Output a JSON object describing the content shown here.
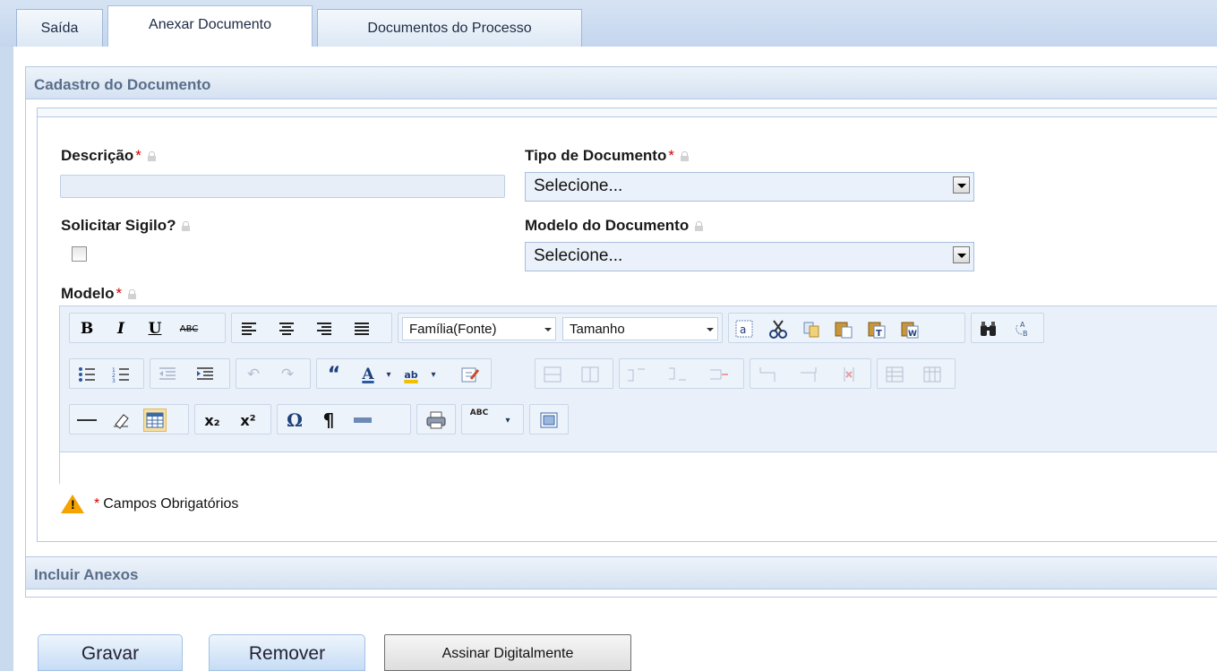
{
  "tabs": [
    {
      "label": "Saída",
      "active": false
    },
    {
      "label": "Anexar Documento",
      "active": true
    },
    {
      "label": "Documentos do Processo",
      "active": false
    }
  ],
  "panel": {
    "title": "Cadastro do Documento"
  },
  "form": {
    "descricao": {
      "label": "Descrição",
      "required": "*",
      "value": ""
    },
    "tipo": {
      "label": "Tipo de Documento",
      "required": "*",
      "selected": "Selecione..."
    },
    "sigilo": {
      "label": "Solicitar Sigilo?",
      "checked": false
    },
    "modelo_doc": {
      "label": "Modelo do Documento",
      "selected": "Selecione..."
    },
    "modelo": {
      "label": "Modelo",
      "required": "*"
    }
  },
  "editor": {
    "font_family": "Família(Fonte)",
    "font_size": "Tamanho",
    "icons": {
      "bold": "B",
      "italic": "I",
      "underline": "U",
      "strike": "ABC",
      "omega": "Ω",
      "pilcrow": "¶",
      "subscript": "x₂",
      "superscript": "x²",
      "quote": "“",
      "font_color": "A",
      "highlight": "ab",
      "spell": "ABC"
    }
  },
  "legend": {
    "mark": "*",
    "text": "Campos Obrigatórios"
  },
  "panel2": {
    "title": "Incluir Anexos"
  },
  "buttons": {
    "gravar": "Gravar",
    "remover": "Remover",
    "assinar": "Assinar Digitalmente"
  },
  "colors": {
    "required": "#d20000",
    "warning": "#f4a300",
    "header_text": "#5a6e8a"
  }
}
